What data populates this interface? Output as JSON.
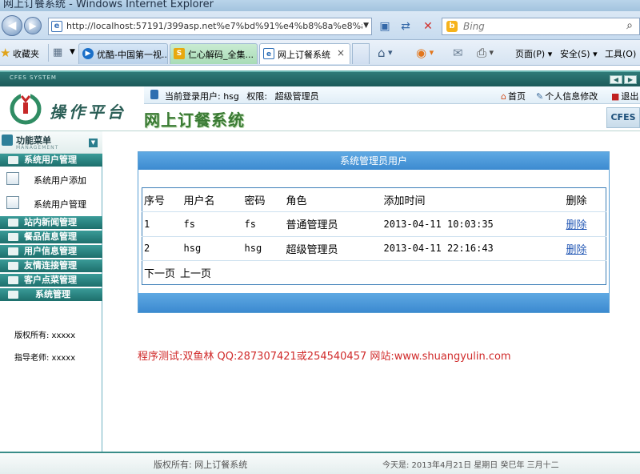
{
  "browser": {
    "window_title": "网上订餐系统 - Windows Internet Explorer",
    "address": "http://localhost:57191/399asp.net%e7%bd%91%e4%b8%8a%e8%ae%a2",
    "search_placeholder": "Bing",
    "favorites_label": "收藏夹",
    "tabs": [
      {
        "label": "优酷-中国第一视..."
      },
      {
        "label": "仁心解码_全集..."
      },
      {
        "label": "网上订餐系统"
      }
    ],
    "menus": {
      "page": "页面(P)",
      "safety": "安全(S)",
      "tools": "工具(O)"
    },
    "icons": [
      "back-arrow-icon",
      "forward-arrow-icon",
      "page-icon",
      "compat-view-icon",
      "refresh-icon",
      "stop-icon",
      "bing-icon",
      "search-icon",
      "star-icon",
      "home-icon",
      "rss-icon",
      "mail-icon",
      "print-icon"
    ]
  },
  "app": {
    "strip_label": "CFES SYSTEM",
    "logo_text": "操作平台",
    "system_title": "网上订餐系统",
    "cfes_tab": "CFES",
    "current_user_label": "当前登录用户: hsg",
    "role_label": "权限:",
    "role_value": "超级管理员",
    "links": {
      "home": "首页",
      "profile": "个人信息修改",
      "logout": "退出"
    },
    "accent_color": "#1d6f6c",
    "panel_color": "#3c8ad0"
  },
  "sidebar": {
    "title": "功能菜单",
    "subtitle": "MANAGEMENT",
    "groups": [
      {
        "label": "系统用户管理"
      },
      {
        "label": "站内新闻管理"
      },
      {
        "label": "餐品信息管理"
      },
      {
        "label": "用户信息管理"
      },
      {
        "label": "友情连接管理"
      },
      {
        "label": "客户点菜管理"
      },
      {
        "label": "系统管理"
      }
    ],
    "items": [
      {
        "label": "系统用户添加"
      },
      {
        "label": "系统用户管理"
      }
    ],
    "copyright": "版权所有: xxxxx",
    "advisor": "指导老师: xxxxx"
  },
  "main": {
    "panel_title": "系统管理员用户",
    "columns": [
      "序号",
      "用户名",
      "密码",
      "角色",
      "添加时间",
      "删除"
    ],
    "rows": [
      {
        "id": "1",
        "username": "fs",
        "password": "fs",
        "role": "普通管理员",
        "added": "2013-04-11 10:03:35",
        "action": "删除"
      },
      {
        "id": "2",
        "username": "hsg",
        "password": "hsg",
        "role": "超级管理员",
        "added": "2013-04-11 22:16:43",
        "action": "删除"
      }
    ],
    "pager": {
      "next": "下一页",
      "prev": "上一页"
    },
    "promo": "程序测试:双鱼林 QQ:287307421或254540457 网站:www.shuangyulin.com"
  },
  "footer": {
    "copyright": "版权所有: 网上订餐系统",
    "date": "今天是: 2013年4月21日 星期日 癸巳年 三月十二"
  }
}
